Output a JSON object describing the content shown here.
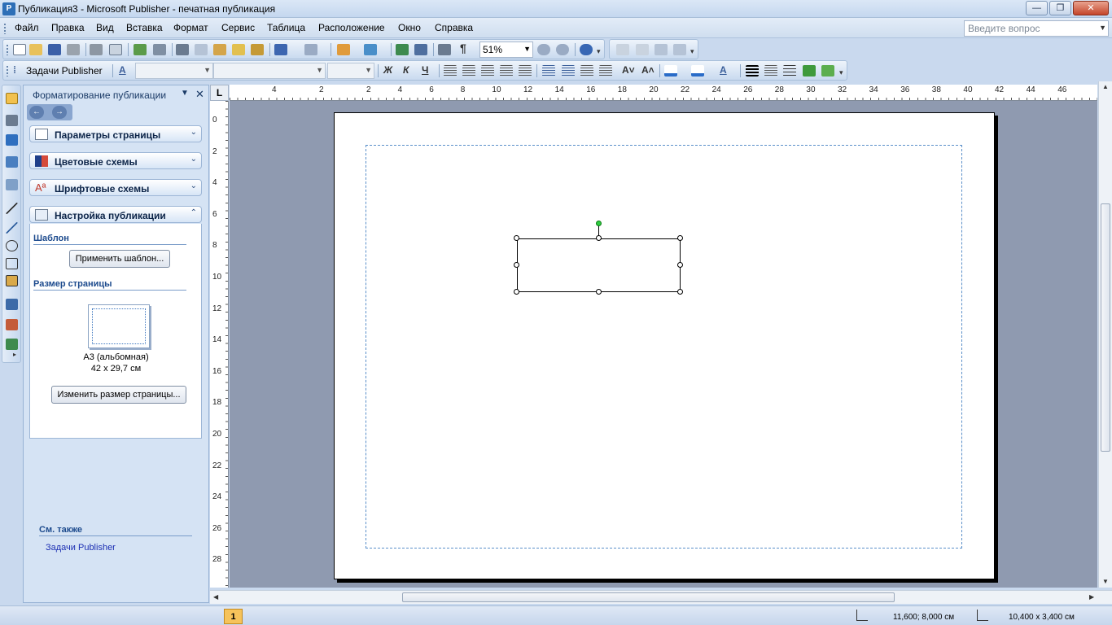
{
  "window": {
    "title": "Публикация3 - Microsoft Publisher - печатная публикация",
    "minimize": "—",
    "maximize": "❐",
    "close": "✕"
  },
  "menu": {
    "items": [
      "Файл",
      "Правка",
      "Вид",
      "Вставка",
      "Формат",
      "Сервис",
      "Таблица",
      "Расположение",
      "Окно",
      "Справка"
    ]
  },
  "help_search": {
    "placeholder": "Введите вопрос"
  },
  "toolbar_standard": {
    "zoom": "51%"
  },
  "toolbar_format": {
    "tasks_label": "Задачи Publisher",
    "bold": "Ж",
    "italic": "К",
    "underline": "Ч"
  },
  "task_pane": {
    "title": "Форматирование публикации",
    "sections": [
      {
        "title": "Параметры страницы",
        "expanded": false
      },
      {
        "title": "Цветовые схемы",
        "expanded": false
      },
      {
        "title": "Шрифтовые схемы",
        "expanded": false
      },
      {
        "title": "Настройка публикации",
        "expanded": true
      }
    ],
    "template_heading": "Шаблон",
    "apply_template_button": "Применить шаблон...",
    "page_size_heading": "Размер страницы",
    "page_size_name": "А3 (альбомная)",
    "page_size_dims": "42 x 29,7 см",
    "change_size_button": "Изменить размер страницы...",
    "see_also_heading": "См. также",
    "see_also_link": "Задачи Publisher"
  },
  "ruler": {
    "corner": "L",
    "h_ticks_left": [
      "4",
      "2"
    ],
    "h_ticks": [
      "2",
      "4",
      "6",
      "8",
      "10",
      "12",
      "14",
      "16",
      "18",
      "20",
      "22",
      "24",
      "26",
      "28",
      "30",
      "32",
      "34",
      "36",
      "38",
      "40",
      "42",
      "44",
      "46"
    ],
    "v_ticks": [
      "0",
      "2",
      "4",
      "6",
      "8",
      "10",
      "12",
      "14",
      "16",
      "18",
      "20",
      "22",
      "24",
      "26",
      "28"
    ]
  },
  "status": {
    "page_number": "1",
    "position": "11,600; 8,000 см",
    "size": "10,400 x  3,400 см"
  },
  "colors": {
    "accent": "#2e6fb7",
    "workspace": "#8f9ab0",
    "rotation_handle": "#2ecc40",
    "page_badge": "#f6c35b"
  }
}
